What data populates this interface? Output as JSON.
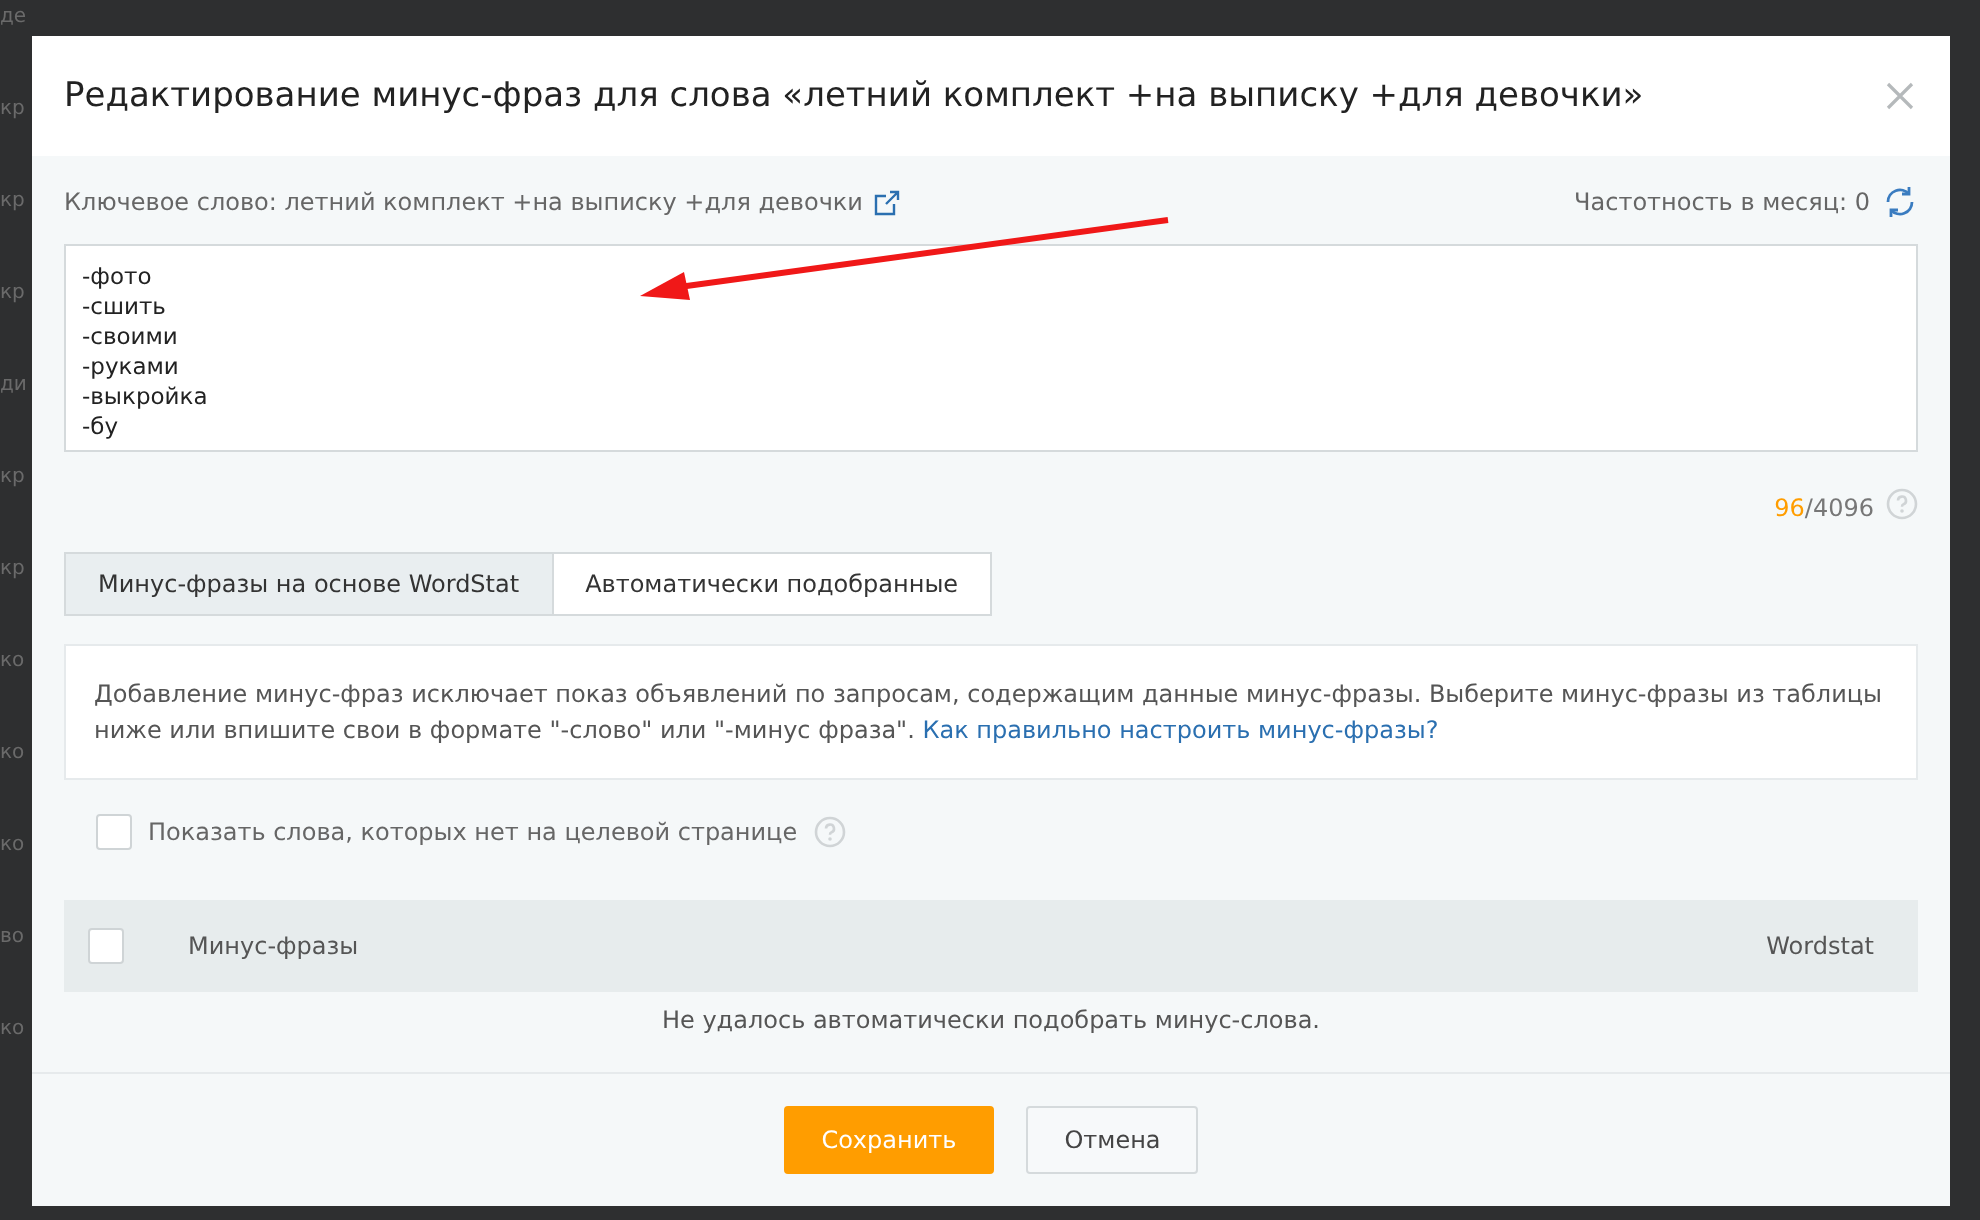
{
  "background_fragments": [
    "де",
    "кр",
    "кр",
    "кр",
    "ди",
    "кр",
    "кр",
    "ко",
    "ко",
    "ко",
    "во",
    "ко"
  ],
  "dialog": {
    "title": "Редактирование минус-фраз для слова «летний комплект +на выписку +для девочки»",
    "keyword_label": "Ключевое слово: летний комплект +на выписку +для девочки",
    "frequency": "Частотность в месяц: 0",
    "minus_phrases": [
      "-фото",
      "-сшить",
      "-своими",
      "-руками",
      "-выкройка",
      "-бу"
    ],
    "counter_used": "96",
    "counter_total": "/4096",
    "tabs": [
      {
        "label": "Минус-фразы на основе WordStat",
        "selected": true
      },
      {
        "label": "Автоматически подобранные",
        "selected": false
      }
    ],
    "info_text": "Добавление минус-фраз исключает показ объявлений по запросам, содержащим данные минус-фразы. Выберите минус-фразы из таблицы ниже или впишите свои в формате \"-слово\" или \"-минус фраза\".",
    "info_link": "Как правильно настроить минус-фразы?",
    "show_missing": {
      "label": "Показать слова, которых нет на целевой странице",
      "checked": false
    },
    "table": {
      "select_all_checked": false,
      "columns": [
        "Минус-фразы",
        "Wordstat"
      ],
      "empty_message": "Не удалось автоматически подобрать минус-слова."
    },
    "buttons": [
      {
        "label": "Сохранить",
        "kind": "primary"
      },
      {
        "label": "Отмена",
        "kind": "secondary"
      }
    ]
  }
}
